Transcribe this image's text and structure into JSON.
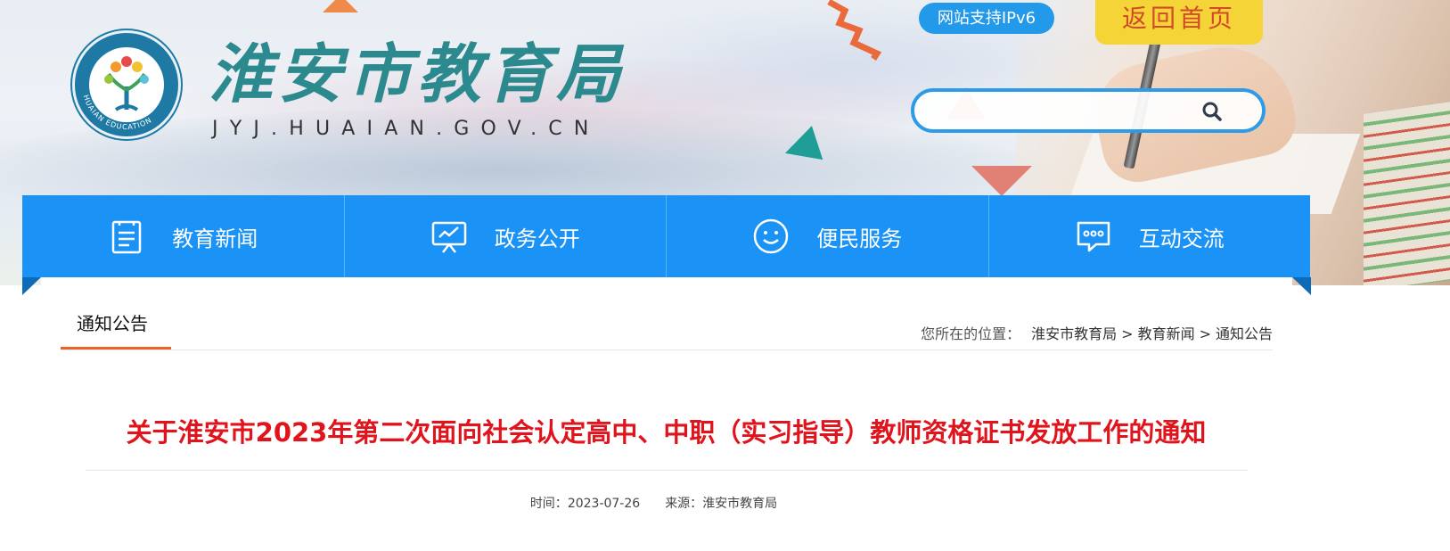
{
  "site": {
    "name": "淮安市教育局",
    "domain": "JYJ.HUAIAN.GOV.CN",
    "logo_ring_text": "HUAIAN EDUCATION",
    "ipv6_badge": "网站支持IPv6",
    "home_button": "返回首页",
    "search": {
      "placeholder": "",
      "value": ""
    }
  },
  "nav": {
    "items": [
      {
        "label": "教育新闻",
        "icon": "document-icon"
      },
      {
        "label": "政务公开",
        "icon": "presentation-icon"
      },
      {
        "label": "便民服务",
        "icon": "smile-icon"
      },
      {
        "label": "互动交流",
        "icon": "chat-icon"
      }
    ]
  },
  "section": {
    "title": "通知公告",
    "breadcrumb_lead": "您所在的位置：",
    "breadcrumb": [
      "淮安市教育局",
      "教育新闻",
      "通知公告"
    ],
    "separator": ">"
  },
  "article": {
    "title": "关于淮安市2023年第二次面向社会认定高中、中职（实习指导）教师资格证书发放工作的通知",
    "time_label": "时间：",
    "time": "2023-07-26",
    "source_label": "来源：",
    "source": "淮安市教育局"
  },
  "colors": {
    "nav_blue": "#1b93f6",
    "title_red": "#e0141c",
    "tab_orange": "#e8632a",
    "home_yellow": "#f5d437",
    "ipv6_blue": "#2299e9"
  }
}
